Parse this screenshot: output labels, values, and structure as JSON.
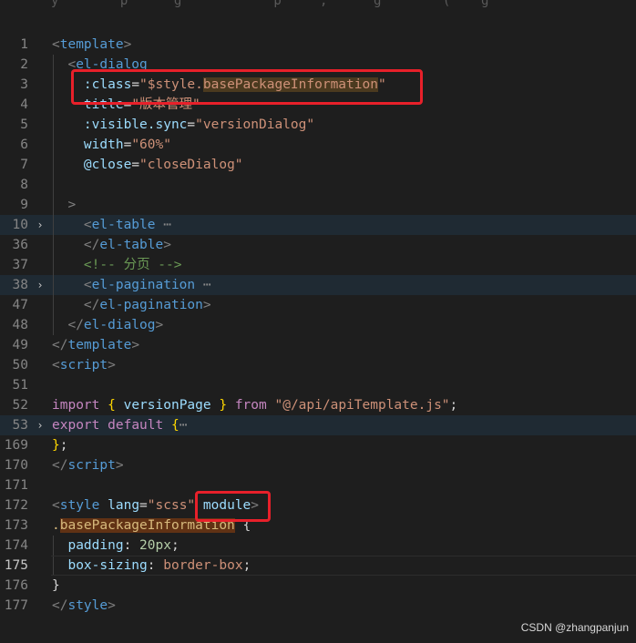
{
  "top_clip": "y        p      g            p     ,      g        (    g",
  "watermark": "CSDN @zhangpanjun",
  "lines": [
    {
      "num": "1",
      "tokens": [
        [
          "t-punc",
          "<"
        ],
        [
          "t-tag",
          "template"
        ],
        [
          "t-punc",
          ">"
        ]
      ]
    },
    {
      "num": "2",
      "indent": 1,
      "tokens": [
        [
          "t-punc",
          "  <"
        ],
        [
          "t-tag",
          "el-dialog"
        ]
      ]
    },
    {
      "num": "3",
      "indent": 1,
      "tokens": [
        [
          "t-plain",
          "    "
        ],
        [
          "t-attr",
          ":class"
        ],
        [
          "t-plain",
          "="
        ],
        [
          "t-str",
          "\"$style."
        ],
        [
          "t-str hl-word",
          "basePackageInformation"
        ],
        [
          "t-str",
          "\""
        ]
      ]
    },
    {
      "num": "4",
      "indent": 1,
      "tokens": [
        [
          "t-plain",
          "    "
        ],
        [
          "t-attr",
          "title"
        ],
        [
          "t-plain",
          "="
        ],
        [
          "t-str",
          "\"版本管理\""
        ]
      ]
    },
    {
      "num": "5",
      "indent": 1,
      "tokens": [
        [
          "t-plain",
          "    "
        ],
        [
          "t-attr",
          ":visible.sync"
        ],
        [
          "t-plain",
          "="
        ],
        [
          "t-str",
          "\"versionDialog\""
        ]
      ]
    },
    {
      "num": "6",
      "indent": 1,
      "tokens": [
        [
          "t-plain",
          "    "
        ],
        [
          "t-attr",
          "width"
        ],
        [
          "t-plain",
          "="
        ],
        [
          "t-str",
          "\"60%\""
        ]
      ]
    },
    {
      "num": "7",
      "indent": 1,
      "tokens": [
        [
          "t-plain",
          "    "
        ],
        [
          "t-attr",
          "@close"
        ],
        [
          "t-plain",
          "="
        ],
        [
          "t-str",
          "\"closeDialog\""
        ]
      ]
    },
    {
      "num": "8",
      "indent": 1,
      "tokens": []
    },
    {
      "num": "9",
      "indent": 1,
      "tokens": [
        [
          "t-punc",
          "  >"
        ]
      ]
    },
    {
      "num": "10",
      "fold": "›",
      "hl": true,
      "indent": 1,
      "tokens": [
        [
          "t-punc",
          "    <"
        ],
        [
          "t-tag",
          "el-table"
        ],
        [
          "t-fold",
          " ⋯"
        ]
      ]
    },
    {
      "num": "36",
      "indent": 1,
      "tokens": [
        [
          "t-punc",
          "    </"
        ],
        [
          "t-tag",
          "el-table"
        ],
        [
          "t-punc",
          ">"
        ]
      ]
    },
    {
      "num": "37",
      "indent": 1,
      "tokens": [
        [
          "t-comment",
          "    <!-- 分页 -->"
        ]
      ]
    },
    {
      "num": "38",
      "fold": "›",
      "hl": true,
      "indent": 1,
      "tokens": [
        [
          "t-punc",
          "    <"
        ],
        [
          "t-tag",
          "el-pagination"
        ],
        [
          "t-fold",
          " ⋯"
        ]
      ]
    },
    {
      "num": "47",
      "indent": 1,
      "tokens": [
        [
          "t-punc",
          "    </"
        ],
        [
          "t-tag",
          "el-pagination"
        ],
        [
          "t-punc",
          ">"
        ]
      ]
    },
    {
      "num": "48",
      "indent": 1,
      "tokens": [
        [
          "t-punc",
          "  </"
        ],
        [
          "t-tag",
          "el-dialog"
        ],
        [
          "t-punc",
          ">"
        ]
      ]
    },
    {
      "num": "49",
      "tokens": [
        [
          "t-punc",
          "</"
        ],
        [
          "t-tag",
          "template"
        ],
        [
          "t-punc",
          ">"
        ]
      ]
    },
    {
      "num": "50",
      "tokens": [
        [
          "t-punc",
          "<"
        ],
        [
          "t-tag",
          "script"
        ],
        [
          "t-punc",
          ">"
        ]
      ]
    },
    {
      "num": "51",
      "tokens": []
    },
    {
      "num": "52",
      "tokens": [
        [
          "t-kw",
          "import"
        ],
        [
          "t-plain",
          " "
        ],
        [
          "t-brace",
          "{"
        ],
        [
          "t-plain",
          " "
        ],
        [
          "t-ident",
          "versionPage"
        ],
        [
          "t-plain",
          " "
        ],
        [
          "t-brace",
          "}"
        ],
        [
          "t-plain",
          " "
        ],
        [
          "t-kw",
          "from"
        ],
        [
          "t-plain",
          " "
        ],
        [
          "t-str",
          "\"@/api/apiTemplate.js\""
        ],
        [
          "t-plain",
          ";"
        ]
      ]
    },
    {
      "num": "53",
      "fold": "›",
      "hl": true,
      "tokens": [
        [
          "t-kw",
          "export"
        ],
        [
          "t-plain",
          " "
        ],
        [
          "t-kw",
          "default"
        ],
        [
          "t-plain",
          " "
        ],
        [
          "t-brace",
          "{"
        ],
        [
          "t-fold",
          "⋯"
        ]
      ]
    },
    {
      "num": "169",
      "tokens": [
        [
          "t-brace",
          "}"
        ],
        [
          "t-plain",
          ";"
        ]
      ]
    },
    {
      "num": "170",
      "tokens": [
        [
          "t-punc",
          "</"
        ],
        [
          "t-tag",
          "script"
        ],
        [
          "t-punc",
          ">"
        ]
      ]
    },
    {
      "num": "171",
      "tokens": []
    },
    {
      "num": "172",
      "tokens": [
        [
          "t-punc",
          "<"
        ],
        [
          "t-tag",
          "style"
        ],
        [
          "t-plain",
          " "
        ],
        [
          "t-attr",
          "lang"
        ],
        [
          "t-plain",
          "="
        ],
        [
          "t-str",
          "\"scss\""
        ],
        [
          "t-plain",
          " "
        ],
        [
          "t-attr",
          "module"
        ],
        [
          "t-punc",
          ">"
        ]
      ]
    },
    {
      "num": "173",
      "tokens": [
        [
          "t-selector",
          "."
        ],
        [
          "t-selector hl-sel",
          "basePackageInformation"
        ],
        [
          "t-plain",
          " "
        ],
        [
          "t-plain",
          "{"
        ]
      ]
    },
    {
      "num": "174",
      "indent": 1,
      "tokens": [
        [
          "t-plain",
          "  "
        ],
        [
          "t-prop",
          "padding"
        ],
        [
          "t-plain",
          ": "
        ],
        [
          "t-num",
          "20px"
        ],
        [
          "t-plain",
          ";"
        ]
      ]
    },
    {
      "num": "175",
      "active": true,
      "current": true,
      "indent": 1,
      "tokens": [
        [
          "t-plain",
          "  "
        ],
        [
          "t-prop",
          "box-sizing"
        ],
        [
          "t-plain",
          ": "
        ],
        [
          "t-val",
          "border-box"
        ],
        [
          "t-plain",
          ";"
        ]
      ]
    },
    {
      "num": "176",
      "tokens": [
        [
          "t-plain",
          "}"
        ]
      ]
    },
    {
      "num": "177",
      "tokens": [
        [
          "t-punc",
          "</"
        ],
        [
          "t-tag",
          "style"
        ],
        [
          "t-punc",
          ">"
        ]
      ]
    }
  ]
}
